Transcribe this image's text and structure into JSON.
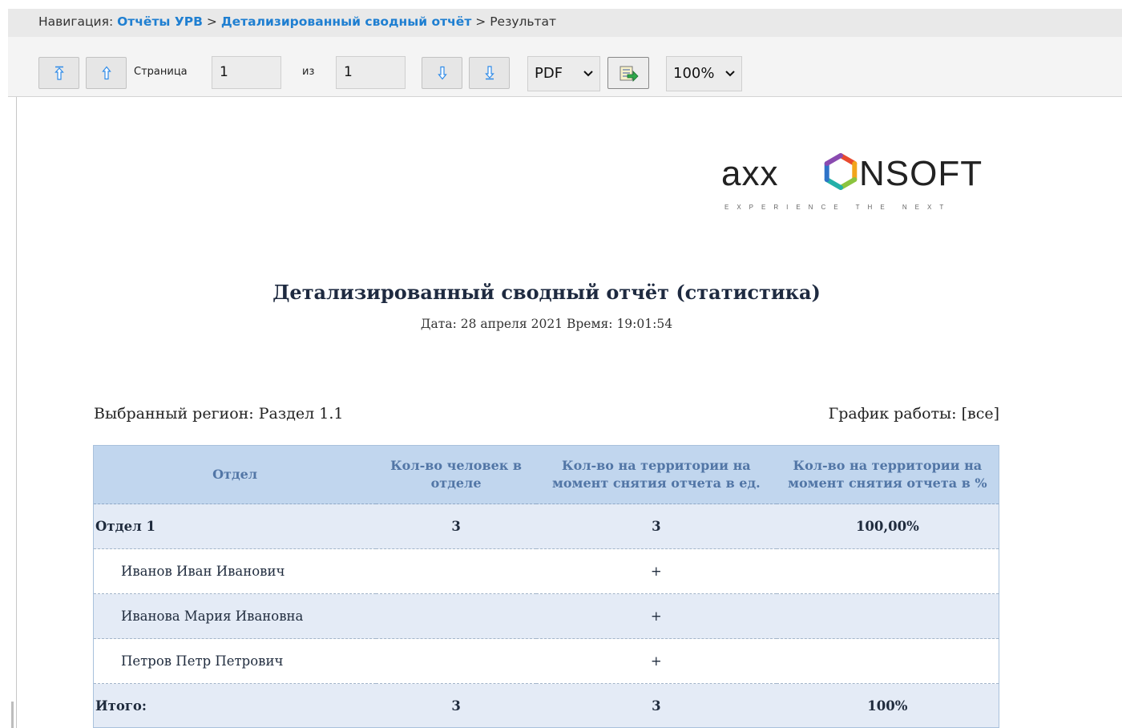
{
  "breadcrumb": {
    "prefix": "Навигация:",
    "items": [
      "Отчёты УРВ",
      "Детализированный сводный отчёт"
    ],
    "sep": ">",
    "current": "Результат"
  },
  "toolbar": {
    "page_label": "Страница",
    "page_value": "1",
    "of_label": "из",
    "total_pages": "1",
    "format": "PDF",
    "zoom": "100%"
  },
  "logo": {
    "brand": "axxonsoft",
    "word_left": "axx",
    "word_right": "nsoft",
    "tagline": "EXPERIENCE THE NEXT"
  },
  "report": {
    "title": "Детализированный сводный отчёт (статистика)",
    "datetime": "Дата: 28 апреля 2021 Время: 19:01:54",
    "region": "Выбранный регион: Раздел 1.1",
    "schedule": "График работы: [все]",
    "columns": [
      "Отдел",
      "Кол-во человек в отделе",
      "Кол-во на территории на момент снятия отчета в ед.",
      "Кол-во на территории на момент снятия отчета в %"
    ],
    "department": {
      "name": "Отдел 1",
      "people": "3",
      "present": "3",
      "percent": "100,00%"
    },
    "employees": [
      {
        "name": "Иванов Иван Иванович",
        "present": "+"
      },
      {
        "name": "Иванова Мария Ивановна",
        "present": "+"
      },
      {
        "name": "Петров Петр Петрович",
        "present": "+"
      }
    ],
    "total": {
      "label": "Итого:",
      "people": "3",
      "present": "3",
      "percent": "100%"
    }
  }
}
